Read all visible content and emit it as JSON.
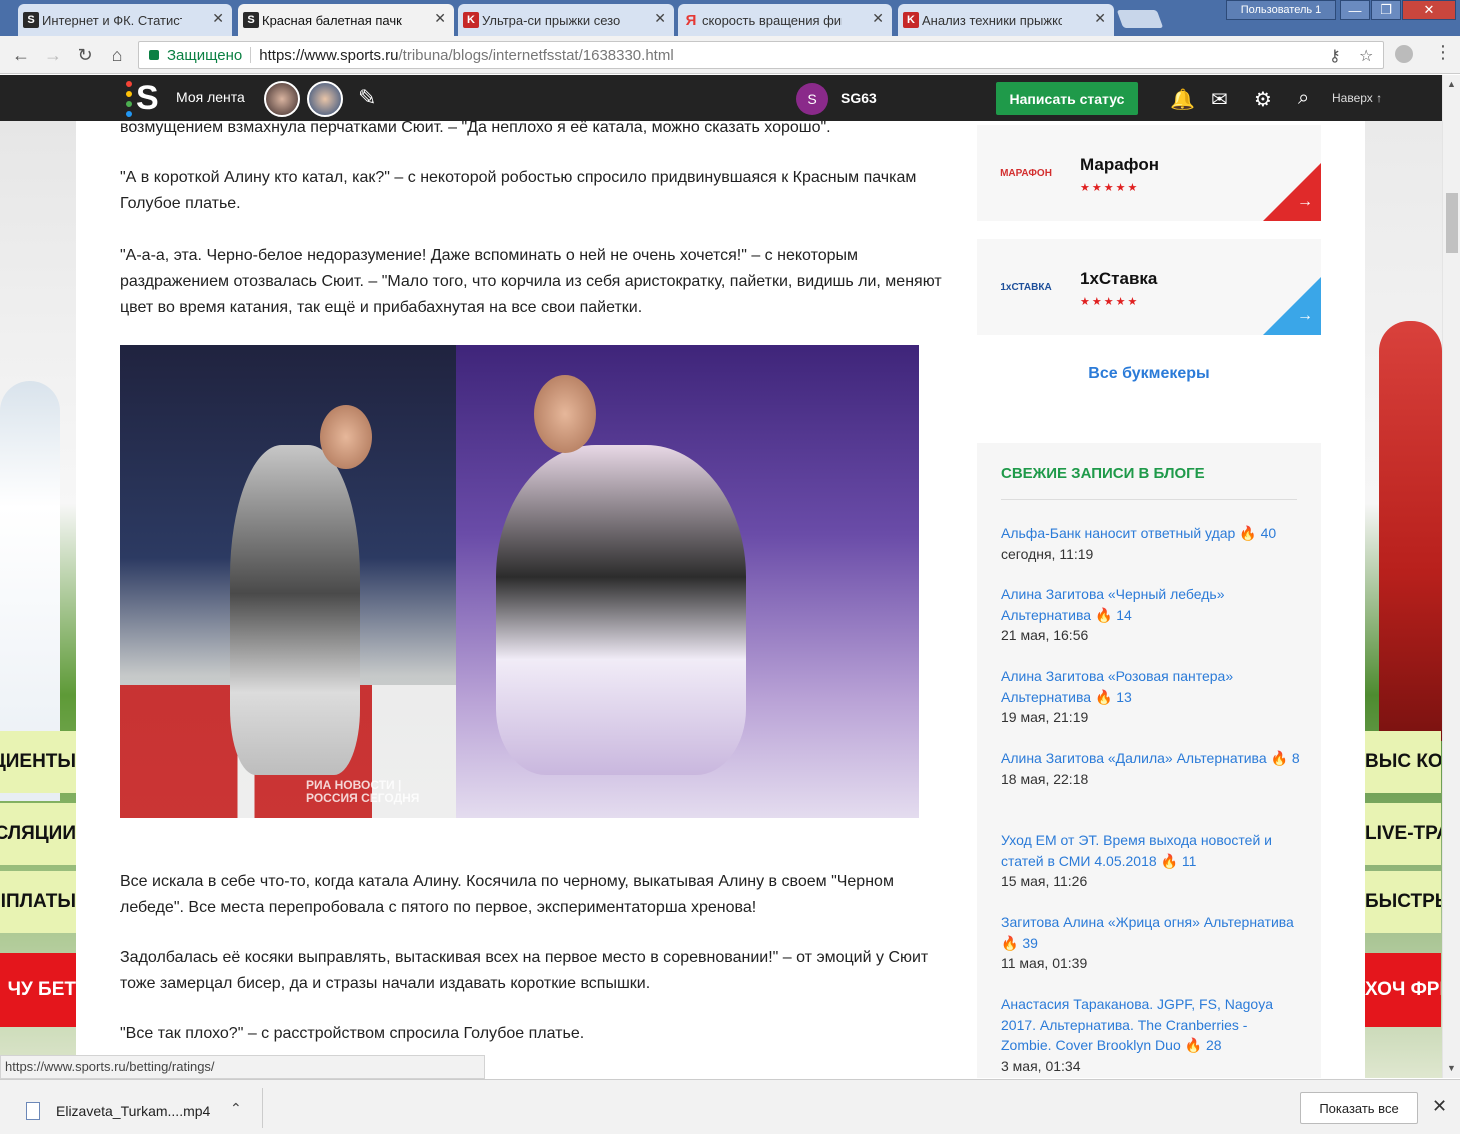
{
  "browser": {
    "tabs": [
      {
        "title": "Интернет и ФК. Статисти",
        "favicon": "S",
        "favicon_color": "#2a2a2a",
        "active": false
      },
      {
        "title": "Красная балетная пачка",
        "favicon": "S",
        "favicon_color": "#2a2a2a",
        "active": true
      },
      {
        "title": "Ультра-си прыжки сезо",
        "favicon": "K",
        "favicon_color": "#c62828",
        "active": false
      },
      {
        "title": "скорость вращения фиг",
        "favicon": "Я",
        "favicon_color": "#e53935",
        "active": false
      },
      {
        "title": "Анализ техники прыжко",
        "favicon": "K",
        "favicon_color": "#c62828",
        "active": false
      }
    ],
    "user_label": "Пользователь 1",
    "secure_label": "Защищено",
    "url_host": "https://www.sports.ru",
    "url_path": "/tribuna/blogs/internetfsstat/1638330.html"
  },
  "site": {
    "my_feed": "Моя лента",
    "user_initial": "S",
    "user_name": "SG63",
    "status_button": "Написать статус",
    "back_to_top": "Наверх"
  },
  "article": {
    "paragraphs": [
      "возмущением взмахнула перчатками Сюит. – \"Да неплохо я её катала, можно сказать хорошо\".",
      "\"А в короткой Алину кто катал, как?\" – с некоторой робостью спросило придвинувшаяся к Красным пачкам Голубое платье.",
      "\"А-а-а, эта. Черно-белое недоразумение! Даже вспоминать о ней не очень хочется!\" – с некоторым раздражением отозвалась Сюит. – \"Мало того, что корчила из себя аристократку, пайетки, видишь ли, меняют цвет во время катания, так ещё и прибабахнутая на все свои пайетки.",
      "Все искала в себе что-то, когда катала Алину. Косячила по черному, выкатывая Алину в своем \"Черном лебеде\". Все места перепробовала с пятого по первое, экспериментаторша хренова!",
      "Задолбалась её косяки выправлять, вытаскивая всех на первое место в соревновании!\" – от эмоций у Сюит тоже замерцал бисер, да и стразы начали издавать короткие вспышки.",
      "\"Все так плохо?\" – с расстройством спросила Голубое платье."
    ],
    "photo_watermark": "РИА НОВОСТИ | РОССИЯ СЕГОДНЯ"
  },
  "sidebar": {
    "bookmakers": [
      {
        "name": "Марафон",
        "logo": "МАРАФОН",
        "stars": "★★★★★",
        "accent": "#e02a2a"
      },
      {
        "name": "1хСтавка",
        "logo": "1хСТАВКА",
        "stars": "★★★★★",
        "accent": "#3aa6e8"
      }
    ],
    "all_bookmakers": "Все букмекеры",
    "blog_title": "СВЕЖИЕ ЗАПИСИ В БЛОГЕ",
    "posts": [
      {
        "title": "Альфа-Банк наносит ответный удар",
        "count": "40",
        "date": "сегодня, 11:19"
      },
      {
        "title": "Алина Загитова «Черный лебедь» Альтернатива",
        "count": "14",
        "date": "21 мая, 16:56"
      },
      {
        "title": "Алина Загитова «Розовая пантера» Альтернатива",
        "count": "13",
        "date": "19 мая, 21:19"
      },
      {
        "title": "Алина Загитова «Далила» Альтернатива",
        "count": "8",
        "date": "18 мая, 22:18"
      },
      {
        "title": "Уход ЕМ от ЭТ. Время выхода новостей и статей в СМИ 4.05.2018",
        "count": "11",
        "date": "15 мая, 11:26"
      },
      {
        "title": "Загитова Алина «Жрица огня» Альтернатива",
        "count": "39",
        "date": "11 мая, 01:39"
      },
      {
        "title": "Анастасия Тараканова. JGPF, FS, Nagoya 2017. Альтернатива. The Cranberries - Zombie. Cover Brooklyn Duo",
        "count": "28",
        "date": "3 мая, 01:34"
      }
    ]
  },
  "ads": {
    "left": [
      "КИЕ ЦИЕНТЫ",
      "СЛЯЦИИ",
      "ВЫПЛАТЫ",
      "ЧУ БЕТ"
    ],
    "right": [
      "ВЫС КОЭФФИ",
      "LIVE-ТРА",
      "БЫСТРЫЕ",
      "ХОЧ ФРИ"
    ]
  },
  "status_bar_url": "https://www.sports.ru/betting/ratings/",
  "downloads": {
    "file": "Elizaveta_Turkam....mp4",
    "show_all": "Показать все"
  }
}
